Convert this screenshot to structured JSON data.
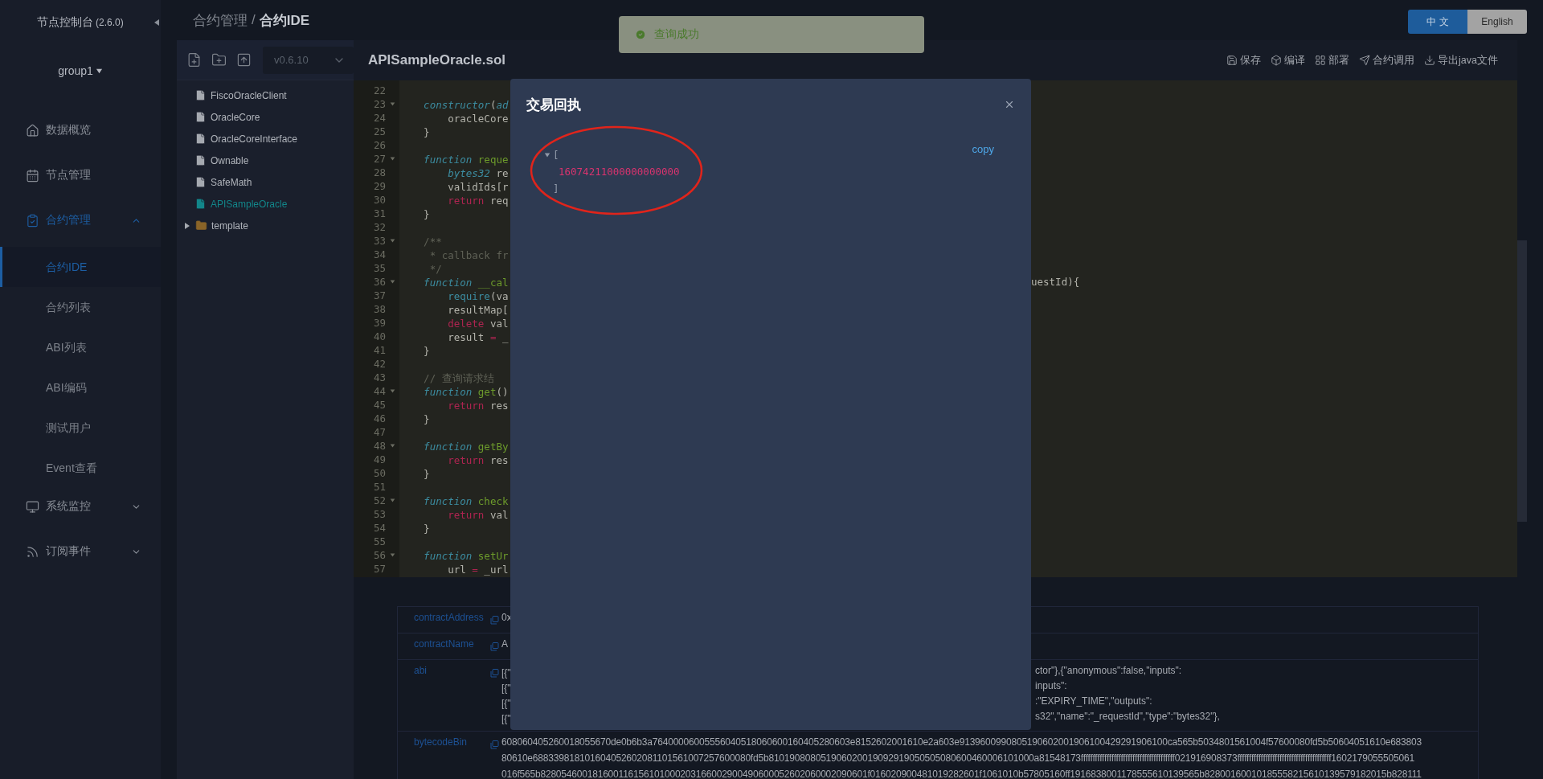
{
  "sidebar": {
    "title": "节点控制台",
    "version": "(2.6.0)",
    "group": "group1",
    "menu": [
      {
        "label": "数据概览",
        "selected": false
      },
      {
        "label": "节点管理",
        "selected": false
      },
      {
        "label": "合约管理",
        "selected": true,
        "expanded": true,
        "children": [
          {
            "label": "合约IDE",
            "selected": true
          },
          {
            "label": "合约列表",
            "selected": false
          },
          {
            "label": "ABI列表",
            "selected": false
          },
          {
            "label": "ABI编码",
            "selected": false
          },
          {
            "label": "测试用户",
            "selected": false
          },
          {
            "label": "Event查看",
            "selected": false
          }
        ]
      },
      {
        "label": "系统监控",
        "selected": false,
        "expanded": false
      },
      {
        "label": "订阅事件",
        "selected": false,
        "expanded": false
      }
    ]
  },
  "breadcrumb": {
    "parent": "合约管理",
    "separator": "/",
    "current": "合约IDE"
  },
  "toast": {
    "kind": "success",
    "message": "查询成功"
  },
  "language": [
    {
      "label": "中 文",
      "selected": true
    },
    {
      "label": "English",
      "selected": false
    }
  ],
  "file_panel": {
    "version": "v0.6.10",
    "tree": [
      {
        "kind": "file",
        "name": "FiscoOracleClient",
        "selected": false
      },
      {
        "kind": "file",
        "name": "OracleCore",
        "selected": false
      },
      {
        "kind": "file",
        "name": "OracleCoreInterface",
        "selected": false
      },
      {
        "kind": "file",
        "name": "Ownable",
        "selected": false
      },
      {
        "kind": "file",
        "name": "SafeMath",
        "selected": false
      },
      {
        "kind": "file",
        "name": "APISampleOracle",
        "selected": true
      },
      {
        "kind": "folder",
        "name": "template",
        "selected": false,
        "expanded": false
      }
    ]
  },
  "editor": {
    "title": "APISampleOracle.sol",
    "actions": [
      "保存",
      "编译",
      "部署",
      "合约调用",
      "导出java文件"
    ],
    "lines": [
      {
        "no": "22",
        "fold": false
      },
      {
        "no": "23",
        "fold": true,
        "tokens": [
          {
            "kind": "kw",
            "text": "    constructor"
          },
          {
            "kind": "p",
            "text": "("
          },
          {
            "kind": "kw",
            "text": "ad"
          }
        ]
      },
      {
        "no": "24",
        "fold": false,
        "tokens": [
          {
            "kind": "p",
            "text": "        oracleCore"
          }
        ]
      },
      {
        "no": "25",
        "fold": false,
        "tokens": [
          {
            "kind": "p",
            "text": "    }"
          }
        ]
      },
      {
        "no": "26",
        "fold": false
      },
      {
        "no": "27",
        "fold": true,
        "tokens": [
          {
            "kind": "kw",
            "text": "    function"
          },
          {
            "kind": "fn",
            "text": " reque"
          }
        ]
      },
      {
        "no": "28",
        "fold": false,
        "tokens": [
          {
            "kind": "kw",
            "text": "        bytes32"
          },
          {
            "kind": "p",
            "text": " re"
          }
        ]
      },
      {
        "no": "29",
        "fold": false,
        "tokens": [
          {
            "kind": "p",
            "text": "        validIds[r"
          }
        ]
      },
      {
        "no": "30",
        "fold": false,
        "tokens": [
          {
            "kind": "red",
            "text": "        return"
          },
          {
            "kind": "p",
            "text": " req"
          }
        ]
      },
      {
        "no": "31",
        "fold": false,
        "tokens": [
          {
            "kind": "p",
            "text": "    }"
          }
        ]
      },
      {
        "no": "32",
        "fold": false
      },
      {
        "no": "33",
        "fold": true,
        "tokens": [
          {
            "kind": "cm",
            "text": "    /**"
          }
        ]
      },
      {
        "no": "34",
        "fold": false,
        "tokens": [
          {
            "kind": "cm",
            "text": "     * callback fr"
          }
        ]
      },
      {
        "no": "35",
        "fold": false,
        "tokens": [
          {
            "kind": "cm",
            "text": "     */"
          }
        ]
      },
      {
        "no": "36",
        "fold": true,
        "tokens": [
          {
            "kind": "kw",
            "text": "    function"
          },
          {
            "kind": "fn",
            "text": " __cal"
          }
        ],
        "right": "uestId){"
      },
      {
        "no": "37",
        "fold": false,
        "tokens": [
          {
            "kind": "bi",
            "text": "        require"
          },
          {
            "kind": "p",
            "text": "(va"
          }
        ]
      },
      {
        "no": "38",
        "fold": false,
        "tokens": [
          {
            "kind": "p",
            "text": "        resultMap["
          }
        ]
      },
      {
        "no": "39",
        "fold": false,
        "tokens": [
          {
            "kind": "red",
            "text": "        delete"
          },
          {
            "kind": "p",
            "text": " val"
          }
        ]
      },
      {
        "no": "40",
        "fold": false,
        "tokens": [
          {
            "kind": "p",
            "text": "        result "
          },
          {
            "kind": "red",
            "text": "="
          },
          {
            "kind": "p",
            "text": " _"
          }
        ]
      },
      {
        "no": "41",
        "fold": false,
        "tokens": [
          {
            "kind": "p",
            "text": "    }"
          }
        ]
      },
      {
        "no": "42",
        "fold": false
      },
      {
        "no": "43",
        "fold": false,
        "tokens": [
          {
            "kind": "cm",
            "text": "    // 查询请求结"
          }
        ]
      },
      {
        "no": "44",
        "fold": true,
        "tokens": [
          {
            "kind": "kw",
            "text": "    function"
          },
          {
            "kind": "fn",
            "text": " get"
          },
          {
            "kind": "p",
            "text": "()"
          }
        ]
      },
      {
        "no": "45",
        "fold": false,
        "tokens": [
          {
            "kind": "red",
            "text": "        return"
          },
          {
            "kind": "p",
            "text": " res"
          }
        ]
      },
      {
        "no": "46",
        "fold": false,
        "tokens": [
          {
            "kind": "p",
            "text": "    }"
          }
        ]
      },
      {
        "no": "47",
        "fold": false
      },
      {
        "no": "48",
        "fold": true,
        "tokens": [
          {
            "kind": "kw",
            "text": "    function"
          },
          {
            "kind": "fn",
            "text": " getBy"
          }
        ]
      },
      {
        "no": "49",
        "fold": false,
        "tokens": [
          {
            "kind": "red",
            "text": "        return"
          },
          {
            "kind": "p",
            "text": " res"
          }
        ]
      },
      {
        "no": "50",
        "fold": false,
        "tokens": [
          {
            "kind": "p",
            "text": "    }"
          }
        ]
      },
      {
        "no": "51",
        "fold": false
      },
      {
        "no": "52",
        "fold": true,
        "tokens": [
          {
            "kind": "kw",
            "text": "    function"
          },
          {
            "kind": "fn",
            "text": " check"
          }
        ]
      },
      {
        "no": "53",
        "fold": false,
        "tokens": [
          {
            "kind": "red",
            "text": "        return"
          },
          {
            "kind": "p",
            "text": " val"
          }
        ]
      },
      {
        "no": "54",
        "fold": false,
        "tokens": [
          {
            "kind": "p",
            "text": "    }"
          }
        ]
      },
      {
        "no": "55",
        "fold": false
      },
      {
        "no": "56",
        "fold": true,
        "tokens": [
          {
            "kind": "kw",
            "text": "    function"
          },
          {
            "kind": "fn",
            "text": " setUr"
          }
        ]
      },
      {
        "no": "57",
        "fold": false,
        "tokens": [
          {
            "kind": "p",
            "text": "        url "
          },
          {
            "kind": "red",
            "text": "="
          },
          {
            "kind": "p",
            "text": " _url"
          }
        ]
      }
    ]
  },
  "details": [
    {
      "label": "contractAddress",
      "kind": "short",
      "lines": [
        {
          "left": "0x"
        }
      ]
    },
    {
      "label": "contractName",
      "kind": "short",
      "lines": [
        {
          "left": "A"
        }
      ]
    },
    {
      "label": "abi",
      "kind": "long",
      "lines": [
        {
          "left": "[{\"",
          "right": "ctor\"},{\"anonymous\":false,\"inputs\":"
        },
        {
          "left": "[{\"",
          "right": "inputs\":"
        },
        {
          "left": "[{\"",
          "right": ":\"EXPIRY_TIME\",\"outputs\":"
        },
        {
          "left": "[{\"",
          "right": "s32\",\"name\":\"_requestId\",\"type\":\"bytes32\"},"
        }
      ]
    },
    {
      "label": "bytecodeBin",
      "kind": "code",
      "lines": [
        {
          "left": "608060405260018055670de0b6b3a76400006005556040518060600160405280603e8152602001610e2a603e9139600990805190602001906100429291906100ca565b5034801561004f57600080fd5b50604051610e683803"
        },
        {
          "left": "80610e688339818101604052602081101561007257600080fd5b810190808051906020019092919050505080600460006101000a81548173ffffffffffffffffffffffffffffffffffffffff021916908373ffffffffffffffffffffffffffffffffffffffff1602179055505061"
        },
        {
          "left": "016f565b828054600181600116156101000203166002900490600052602060002090601f016020900481019282601f1061010b57805160ff1916838001178555610139565b82800160010185558215610139579182015b828111"
        }
      ]
    }
  ],
  "modal": {
    "title": "交易回执",
    "copy": "copy",
    "expanded": true,
    "open": "[",
    "values": [
      {
        "text": "16074211000000000000",
        "highlighted": true
      }
    ],
    "close": "]"
  }
}
